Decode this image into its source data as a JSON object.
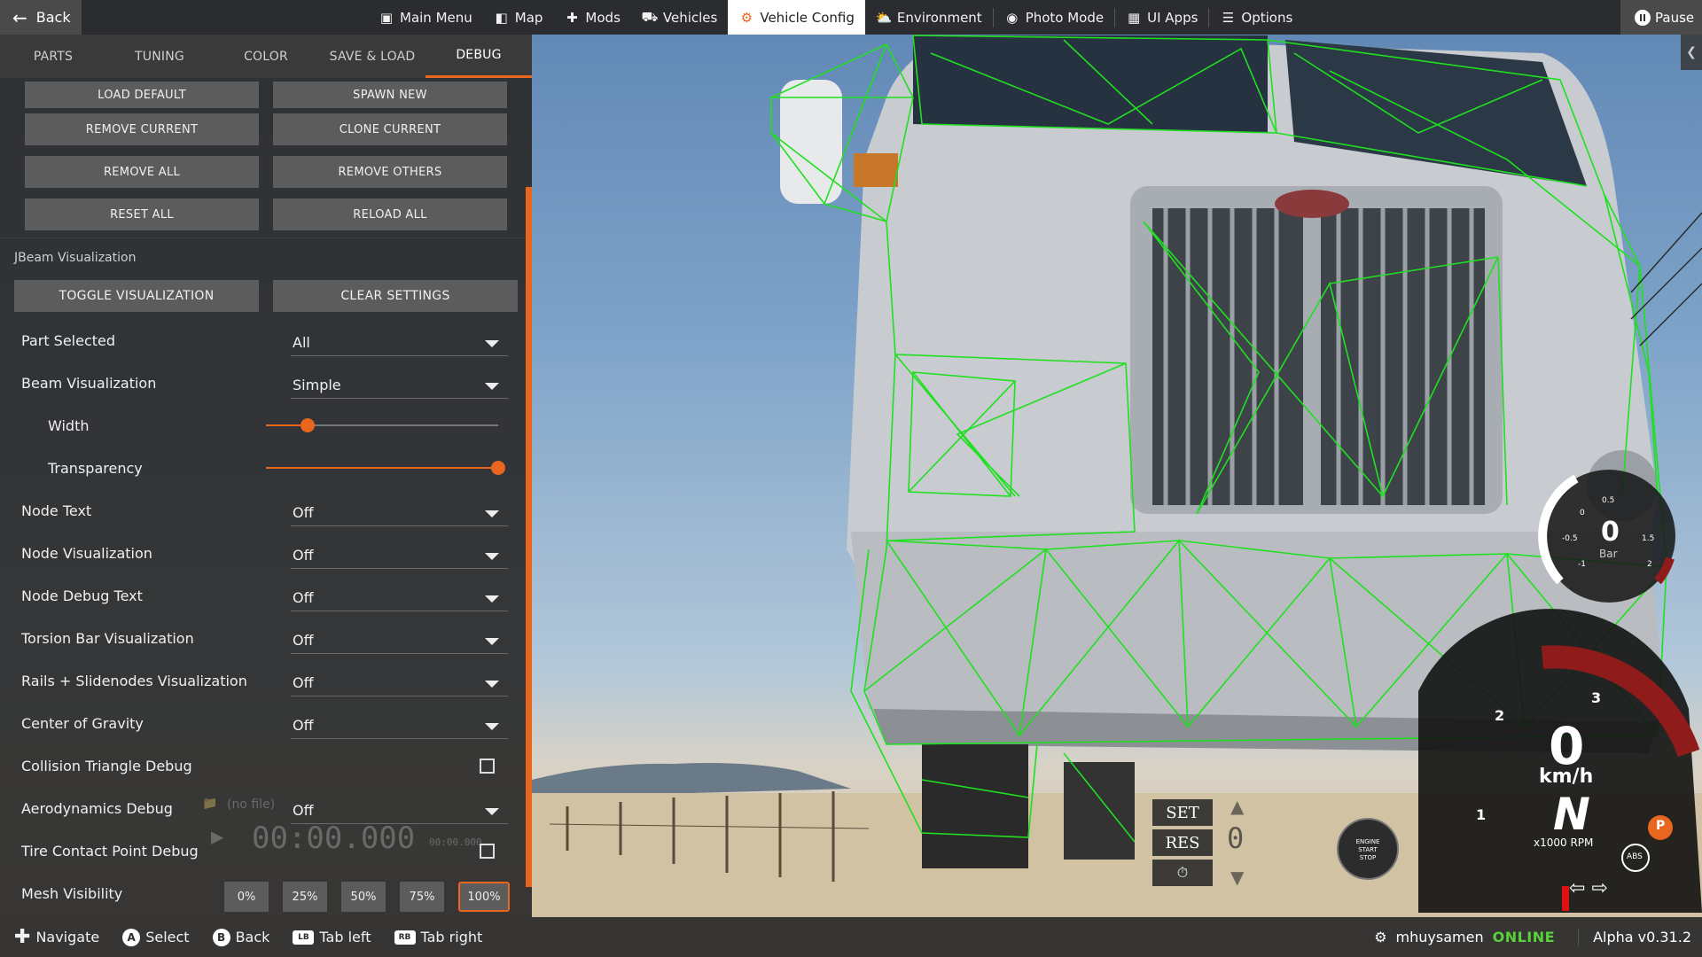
{
  "topbar": {
    "back_label": "Back",
    "menu": [
      {
        "label": "Main Menu",
        "icon": "main-menu-icon"
      },
      {
        "label": "Map",
        "icon": "map-icon"
      },
      {
        "label": "Mods",
        "icon": "puzzle-icon"
      },
      {
        "label": "Vehicles",
        "icon": "car-icon"
      },
      {
        "label": "Vehicle Config",
        "icon": "engine-icon",
        "active": true
      },
      {
        "label": "Environment",
        "icon": "weather-icon"
      },
      {
        "label": "Photo Mode",
        "icon": "camera-icon"
      },
      {
        "label": "UI Apps",
        "icon": "ui-apps-icon"
      },
      {
        "label": "Options",
        "icon": "sliders-icon"
      }
    ],
    "pause_label": "Pause"
  },
  "panel": {
    "tabs": [
      "PARTS",
      "TUNING",
      "COLOR",
      "SAVE & LOAD",
      "DEBUG"
    ],
    "active_tab": "DEBUG",
    "buttons": [
      [
        "LOAD DEFAULT",
        "SPAWN NEW"
      ],
      [
        "REMOVE CURRENT",
        "CLONE CURRENT"
      ],
      [
        "REMOVE ALL",
        "REMOVE OTHERS"
      ],
      [
        "RESET ALL",
        "RELOAD ALL"
      ]
    ],
    "section_title": "JBeam Visualization",
    "toggle_label": "TOGGLE VISUALIZATION",
    "clear_label": "CLEAR SETTINGS",
    "options": {
      "part_selected": {
        "label": "Part Selected",
        "value": "All"
      },
      "beam_visualization": {
        "label": "Beam Visualization",
        "value": "Simple"
      },
      "width": {
        "label": "Width",
        "value": 0.18
      },
      "transparency": {
        "label": "Transparency",
        "value": 1.0
      },
      "node_text": {
        "label": "Node Text",
        "value": "Off"
      },
      "node_visualization": {
        "label": "Node Visualization",
        "value": "Off"
      },
      "node_debug_text": {
        "label": "Node Debug Text",
        "value": "Off"
      },
      "torsion_bar": {
        "label": "Torsion Bar Visualization",
        "value": "Off"
      },
      "rails": {
        "label": "Rails + Slidenodes Visualization",
        "value": "Off"
      },
      "center_of_gravity": {
        "label": "Center of Gravity",
        "value": "Off"
      },
      "collision_triangle": {
        "label": "Collision Triangle Debug",
        "checked": false
      },
      "aerodynamics": {
        "label": "Aerodynamics Debug",
        "value": "Off"
      },
      "tire_contact": {
        "label": "Tire Contact Point Debug",
        "checked": false
      },
      "mesh_visibility": {
        "label": "Mesh Visibility",
        "options": [
          "0%",
          "25%",
          "50%",
          "75%",
          "100%"
        ],
        "selected": "100%"
      }
    },
    "ghost": {
      "no_file": "(no file)",
      "timer": "00:00.000",
      "small_timer": "00:00.000"
    }
  },
  "hud": {
    "boost_value": "0",
    "boost_unit": "Bar",
    "boost_ticks": [
      "0",
      "0.5",
      "-0.5",
      "1.5",
      "-1",
      "2"
    ],
    "speed": "0",
    "speed_unit": "km/h",
    "gear": "N",
    "rpm_unit": "x1000 RPM",
    "rpm_ticks": [
      "1",
      "2",
      "3"
    ],
    "set_label": "SET",
    "res_label": "RES",
    "cc_speed": "0",
    "engine_label": [
      "ENGINE",
      "START",
      "STOP"
    ],
    "abs_label": "ABS",
    "parking_label": "P"
  },
  "bottombar": {
    "hints": [
      {
        "icon": "dpad-icon",
        "label": "Navigate"
      },
      {
        "icon": "a-button-icon",
        "glyph": "A",
        "label": "Select"
      },
      {
        "icon": "b-button-icon",
        "glyph": "B",
        "label": "Back"
      },
      {
        "icon": "lb-button-icon",
        "glyph": "LB",
        "label": "Tab left"
      },
      {
        "icon": "rb-button-icon",
        "glyph": "RB",
        "label": "Tab right"
      }
    ],
    "username": "mhuysamen",
    "status": "ONLINE",
    "version": "Alpha v0.31.2"
  },
  "colors": {
    "accent": "#e8661d",
    "online": "#5ad13b",
    "wireframe": "#1fe01f"
  }
}
